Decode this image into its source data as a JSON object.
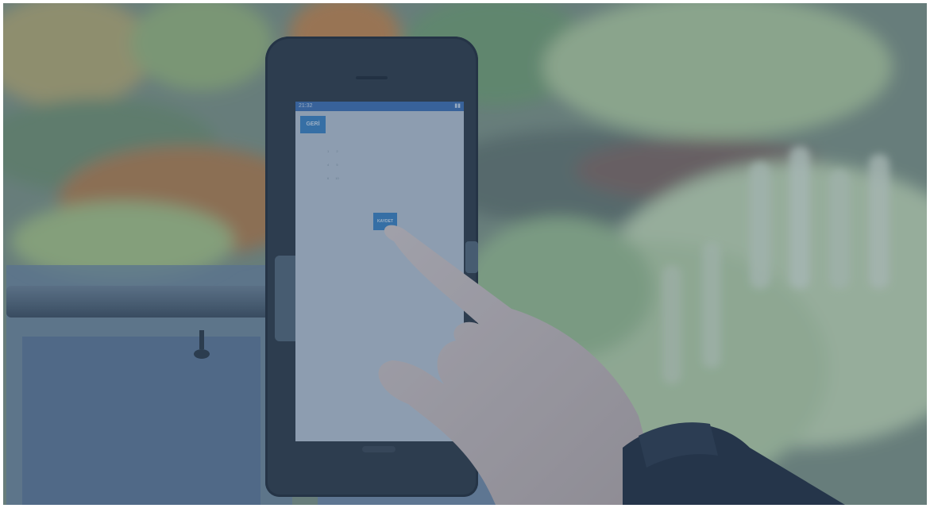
{
  "photo": {
    "scene": "produce-aisle-tablet-on-cart",
    "palette": {
      "tint": "#304e76",
      "produce_green": "#b7cf8a",
      "produce_orange": "#c98a4a",
      "screen": "#c7ced3",
      "button_blue": "#3b84c2",
      "tablet_case": "#2c3338",
      "skin": "#d9c5bb",
      "sleeve": "#1f2630"
    }
  },
  "tablet": {
    "status_time": "21:32",
    "back_label": "GERİ",
    "save_label": "KAYDET",
    "table_rows": [
      [
        "1",
        "2",
        "",
        ""
      ],
      [
        "4",
        "5",
        "",
        ""
      ],
      [
        "6",
        "10",
        "",
        ""
      ]
    ]
  }
}
